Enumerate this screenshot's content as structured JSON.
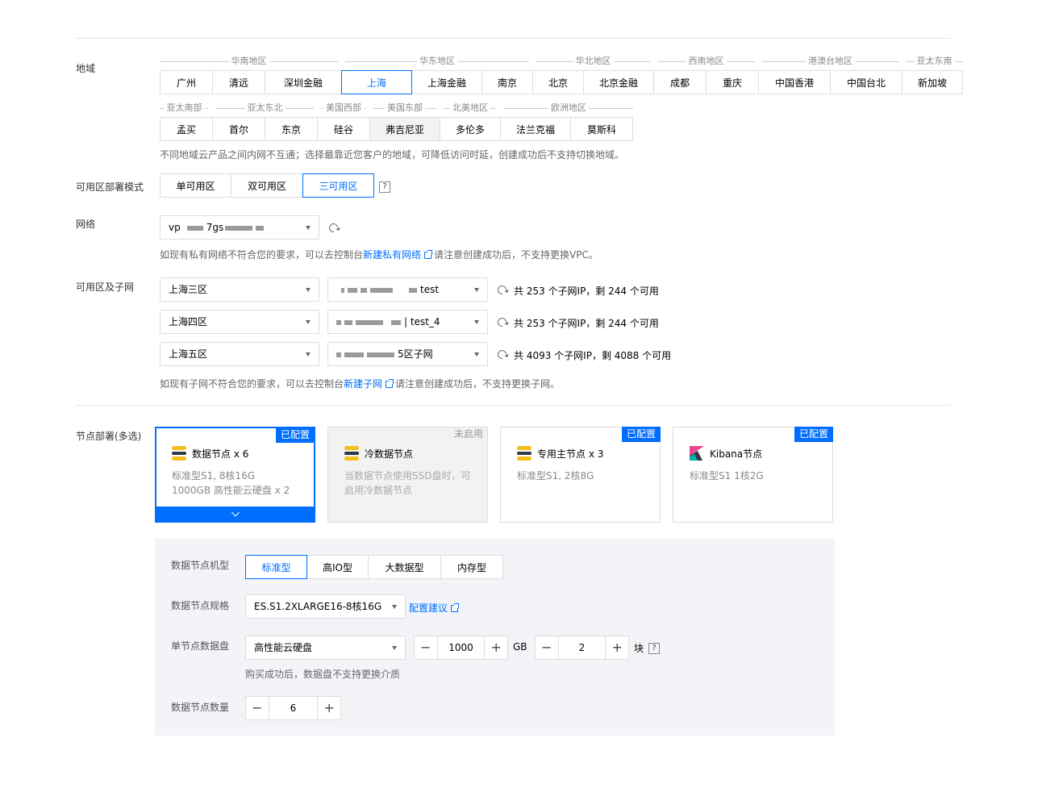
{
  "region": {
    "label": "地域",
    "row1": [
      {
        "group": "华南地区",
        "items": [
          "广州",
          "清远",
          "深圳金融"
        ]
      },
      {
        "group": "华东地区",
        "items": [
          "上海",
          "上海金融",
          "南京"
        ]
      },
      {
        "group": "华北地区",
        "items": [
          "北京",
          "北京金融"
        ]
      },
      {
        "group": "西南地区",
        "items": [
          "成都",
          "重庆"
        ]
      },
      {
        "group": "港澳台地区",
        "items": [
          "中国香港",
          "中国台北"
        ]
      },
      {
        "group": "亚太东南",
        "items": [
          "新加坡"
        ]
      }
    ],
    "row2": [
      {
        "group": "亚太南部",
        "items": [
          "孟买"
        ]
      },
      {
        "group": "亚太东北",
        "items": [
          "首尔",
          "东京"
        ]
      },
      {
        "group": "美国西部",
        "items": [
          "硅谷"
        ]
      },
      {
        "group": "美国东部",
        "items": [
          "弗吉尼亚"
        ]
      },
      {
        "group": "北美地区",
        "items": [
          "多伦多"
        ]
      },
      {
        "group": "欧洲地区",
        "items": [
          "法兰克福",
          "莫斯科"
        ]
      }
    ],
    "selected": "上海",
    "hovered": "弗吉尼亚",
    "note": "不同地域云产品之间内网不互通；选择最靠近您客户的地域，可降低访问时延，创建成功后不支持切换地域。"
  },
  "az_mode": {
    "label": "可用区部署模式",
    "options": [
      "单可用区",
      "双可用区",
      "三可用区"
    ],
    "selected": "三可用区",
    "help": "?"
  },
  "network": {
    "label": "网络",
    "value_prefix": "vp",
    "value_mid": "7gs",
    "refresh_icon": "refresh-icon",
    "note_before": "如现有私有网络不符合您的要求，可以去控制台",
    "note_link": "新建私有网络",
    "note_after": "请注意创建成功后，不支持更换VPC。"
  },
  "subnets": {
    "label": "可用区及子网",
    "rows": [
      {
        "zone": "上海三区",
        "subnet": "test",
        "info": "共 253 个子网IP，剩 244 个可用"
      },
      {
        "zone": "上海四区",
        "subnet": "| test_4",
        "info": "共 253 个子网IP，剩 244 个可用"
      },
      {
        "zone": "上海五区",
        "subnet": "5区子网",
        "info": "共 4093 个子网IP，剩 4088 个可用"
      }
    ],
    "note_before": "如现有子网不符合您的要求，可以去控制台",
    "note_link": "新建子网",
    "note_after": "请注意创建成功后，不支持更换子网。"
  },
  "nodes": {
    "label": "节点部署(多选)",
    "cards": [
      {
        "title": "数据节点 x 6",
        "desc1": "标准型S1, 8核16G",
        "desc2": "1000GB 高性能云硬盘 x 2",
        "badge": "已配置"
      },
      {
        "title": "冷数据节点",
        "desc1": "当数据节点使用SSD盘时，可",
        "desc2": "启用冷数据节点",
        "badge": "未启用"
      },
      {
        "title": "专用主节点 x 3",
        "desc1": "标准型S1, 2核8G",
        "desc2": "",
        "badge": "已配置"
      },
      {
        "title": "Kibana节点",
        "desc1": "标准型S1 1核2G",
        "desc2": "",
        "badge": "已配置"
      }
    ]
  },
  "config": {
    "type_label": "数据节点机型",
    "types": [
      "标准型",
      "高IO型",
      "大数据型",
      "内存型"
    ],
    "type_selected": "标准型",
    "spec_label": "数据节点规格",
    "spec_value": "ES.S1.2XLARGE16-8核16G",
    "spec_link": "配置建议",
    "disk_label": "单节点数据盘",
    "disk_type": "高性能云硬盘",
    "disk_size": "1000",
    "disk_unit": "GB",
    "disk_count": "2",
    "disk_count_unit": "块",
    "disk_help": "?",
    "disk_note": "购买成功后，数据盘不支持更换介质",
    "count_label": "数据节点数量",
    "node_count": "6",
    "minus": "−",
    "plus": "+"
  }
}
